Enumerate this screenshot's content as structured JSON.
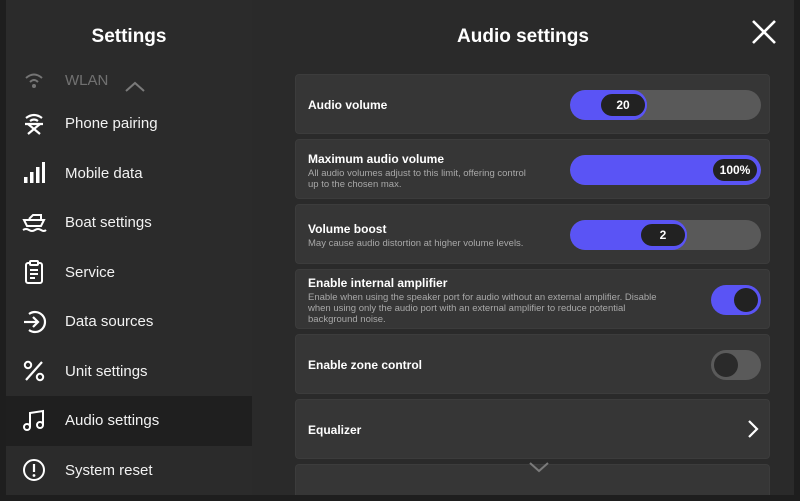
{
  "sidebar": {
    "title": "Settings",
    "partial_item": "WLAN",
    "items": [
      {
        "label": "Phone pairing",
        "icon": "phone-pairing-icon"
      },
      {
        "label": "Mobile data",
        "icon": "signal-bars-icon"
      },
      {
        "label": "Boat settings",
        "icon": "boat-icon"
      },
      {
        "label": "Service",
        "icon": "clipboard-icon"
      },
      {
        "label": "Data sources",
        "icon": "data-source-icon"
      },
      {
        "label": "Unit settings",
        "icon": "percent-icon"
      },
      {
        "label": "Audio settings",
        "icon": "music-note-icon"
      },
      {
        "label": "System reset",
        "icon": "exclamation-circle-icon"
      }
    ],
    "active_index": 6
  },
  "main": {
    "title": "Audio settings",
    "rows": {
      "audio_volume": {
        "label": "Audio volume",
        "value": "20",
        "fill_percent": 40
      },
      "max_volume": {
        "label": "Maximum audio volume",
        "description_line1": "All audio volumes adjust to this limit, offering control",
        "description_line2": "up to the chosen max.",
        "value": "100%",
        "fill_percent": 100
      },
      "volume_boost": {
        "label": "Volume boost",
        "description": "May cause audio distortion at higher volume levels.",
        "value": "2",
        "fill_percent": 61
      },
      "internal_amp": {
        "label": "Enable internal amplifier",
        "description_line1": "Enable when using the speaker port for audio without an external amplifier. Disable",
        "description_line2": "when using only the audio port with an external amplifier to reduce potential",
        "description_line3": "background noise.",
        "enabled": true
      },
      "zone_control": {
        "label": "Enable zone control",
        "enabled": false
      },
      "equalizer": {
        "label": "Equalizer"
      }
    }
  },
  "colors": {
    "accent": "#5a54f5",
    "sidebar_bg": "#2b2b2b",
    "main_bg": "#2a2a2a",
    "row_bg": "#363636"
  }
}
